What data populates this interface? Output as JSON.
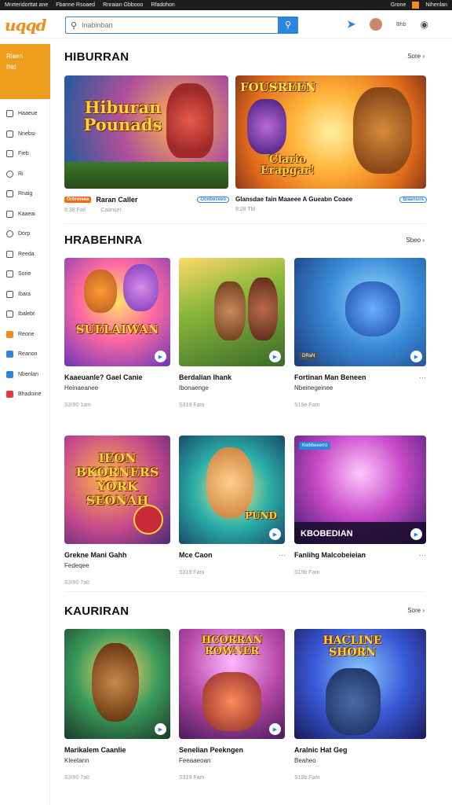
{
  "topbar": {
    "left1": "Mnrteridorttat ane",
    "left2": "Fbanne Rsoaed",
    "left3": "Rnraian Gbbooo",
    "left4": "Rfadohon",
    "right1": "Grone",
    "right2": "Nihenlan"
  },
  "header": {
    "logo": "uqqd",
    "search_placeholder": "Inabinban",
    "icon3": "Bhb"
  },
  "sidebar": {
    "feature_line1": "Rlaen",
    "feature_line2": "INd",
    "items": [
      "Haaeue",
      "Nnebsi",
      "Fieb",
      "Ri",
      "Rnaig",
      "Kaaeai",
      "Dorp",
      "Reeda",
      "Sorie",
      "Ibara",
      "Ibalebt",
      "Reorie",
      "Reanon",
      "Nbenlan",
      "Bhadoine"
    ]
  },
  "sections": [
    {
      "title": "HIBURRAN",
      "see_all": "Sore ›"
    },
    {
      "title": "HRABEHNRA",
      "see_all": "Sbeo ›"
    },
    {
      "title": "KAURIRAN",
      "see_all": "Sore ›"
    }
  ],
  "featured": [
    {
      "art_title": "Hiburan Pounads",
      "tag": "Orbrmeea",
      "title": "Raran Caller",
      "badge": "Oonbeseeo",
      "date": "8:38 Fail",
      "date2": "Caanser"
    },
    {
      "art_title": "Clario Erapgar!",
      "art_top": "FOUSREEN",
      "title": "Glansdae fain Maaeee A Gueabn Coaee",
      "badge": "Biaansos",
      "date": "8:28 Tbl"
    }
  ],
  "row2": [
    {
      "art_title": "SUELAIWAN",
      "title": "Kaaeuanle? Gael Canie",
      "sub": "Heinaeanee",
      "date": "S3!90 1am"
    },
    {
      "art_title": "",
      "title": "Berdalian Ihank",
      "sub": "Ibonaenge",
      "date": "S319 Fam"
    },
    {
      "art_title": "",
      "tag": "DRaN",
      "title": "Fortinan Man Beneen",
      "sub": "Nbeinegeinee",
      "date": "S19e Fam"
    }
  ],
  "row3": [
    {
      "art_title": "IEON BKORNERS YORK SEONAH",
      "title": "Grekne Mani Gahh",
      "sub": "Fedeqee",
      "date": "S3!90 7a0"
    },
    {
      "art_title": "PUND",
      "title": "Mce Caon",
      "sub": "",
      "date": "S319 Fam"
    },
    {
      "art_title": "KBOBEDIAN",
      "tag": "Kwbbeeerro",
      "title": "Fanlihg Malcobeieian",
      "sub": "",
      "date": "S19b Fam"
    }
  ],
  "row4": [
    {
      "art_title": "",
      "title": "Marikalem Caanlie",
      "sub": "Kleetann",
      "date": "S3!90 7a0"
    },
    {
      "art_title": "HCORRAN ROWNER",
      "title": "Senelian Peekngen",
      "sub": "Feeaaeoan",
      "date": "S319 Fam"
    },
    {
      "art_title": "HACLINE SHORN",
      "title": "Aralnic Hat Geg",
      "sub": "Beaheo",
      "date": "S19b Fam"
    }
  ]
}
